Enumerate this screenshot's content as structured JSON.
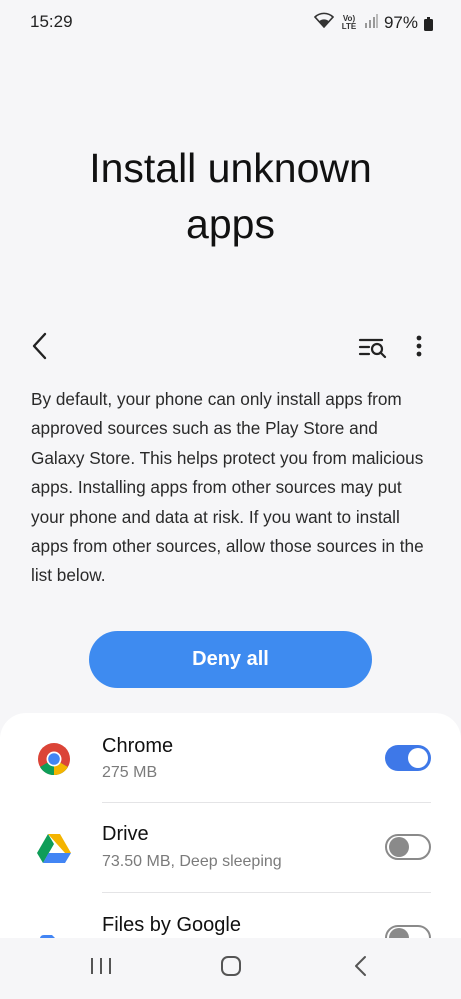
{
  "status_bar": {
    "time": "15:29",
    "network_label": "Vo) LTE",
    "battery_text": "97%"
  },
  "page": {
    "title_line1": "Install unknown",
    "title_line2": "apps",
    "description": "By default, your phone can only install apps from approved sources such as the Play Store and Galaxy Store. This helps protect you from malicious apps. Installing apps from other sources may put your phone and data at risk. If you want to install apps from other sources, allow those sources in the list below.",
    "deny_all_label": "Deny all"
  },
  "apps": [
    {
      "name": "Chrome",
      "detail": "275 MB",
      "allowed": true,
      "icon": "chrome-icon"
    },
    {
      "name": "Drive",
      "detail": "73.50 MB, Deep sleeping",
      "allowed": false,
      "icon": "google-drive-icon"
    },
    {
      "name": "Files by Google",
      "detail": "",
      "allowed": false,
      "icon": "files-by-google-icon"
    }
  ],
  "colors": {
    "accent": "#3e8bf0",
    "toggle_on": "#3e78e8",
    "background": "#f6f6f8"
  }
}
